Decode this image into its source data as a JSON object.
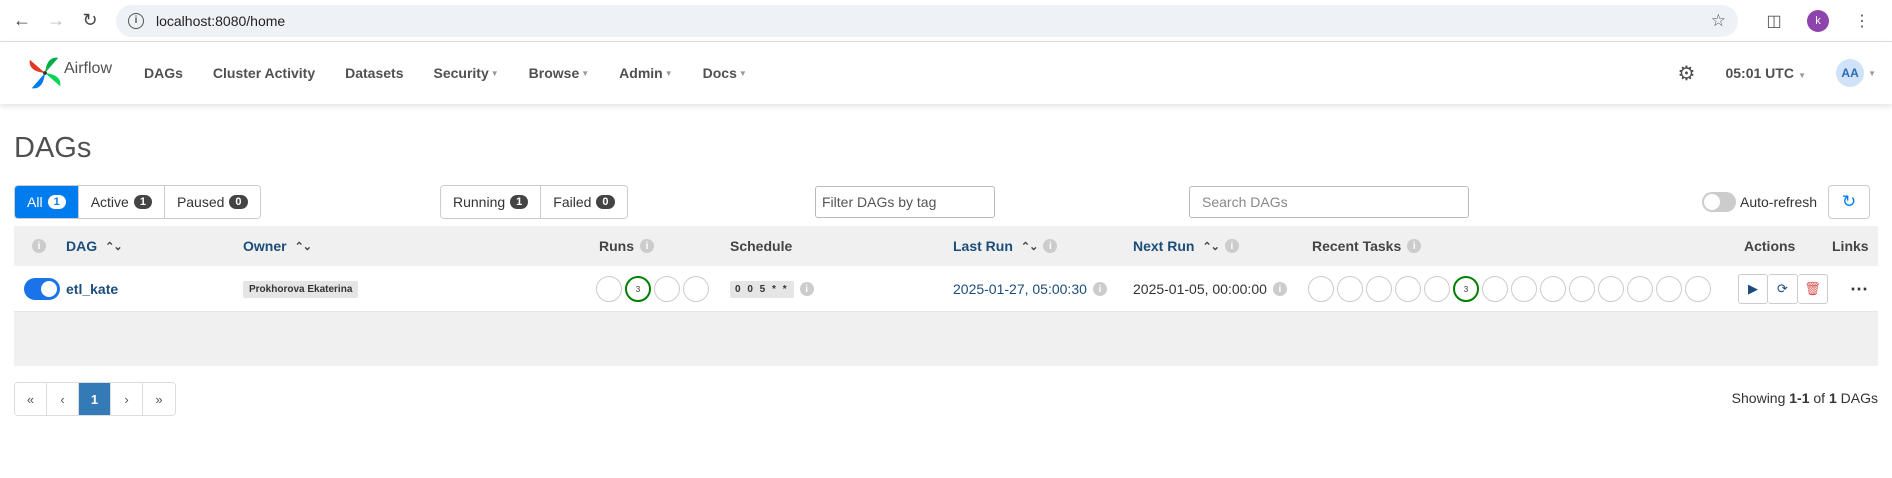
{
  "browser": {
    "url": "localhost:8080/home",
    "profile_initial": "k"
  },
  "navbar": {
    "brand": "Airflow",
    "menu": [
      {
        "label": "DAGs",
        "dropdown": false
      },
      {
        "label": "Cluster Activity",
        "dropdown": false
      },
      {
        "label": "Datasets",
        "dropdown": false
      },
      {
        "label": "Security",
        "dropdown": true
      },
      {
        "label": "Browse",
        "dropdown": true
      },
      {
        "label": "Admin",
        "dropdown": true
      },
      {
        "label": "Docs",
        "dropdown": true
      }
    ],
    "time": "05:01 UTC",
    "user_initials": "AA"
  },
  "page": {
    "title": "DAGs"
  },
  "filters": {
    "all_label": "All",
    "all_count": "1",
    "active_label": "Active",
    "active_count": "1",
    "paused_label": "Paused",
    "paused_count": "0",
    "running_label": "Running",
    "running_count": "1",
    "failed_label": "Failed",
    "failed_count": "0",
    "tag_placeholder": "Filter DAGs by tag",
    "search_placeholder": "Search DAGs",
    "autorefresh_label": "Auto-refresh"
  },
  "table": {
    "headers": {
      "dag": "DAG",
      "owner": "Owner",
      "runs": "Runs",
      "schedule": "Schedule",
      "last_run": "Last Run",
      "next_run": "Next Run",
      "recent_tasks": "Recent Tasks",
      "actions": "Actions",
      "links": "Links"
    },
    "rows": [
      {
        "dag_id": "etl_kate",
        "owner": "Prokhorova Ekaterina",
        "runs_success_count": "3",
        "schedule": "0 0 5 * *",
        "last_run": "2025-01-27, 05:00:30",
        "next_run": "2025-01-05, 00:00:00",
        "recent_tasks_success_count": "3"
      }
    ]
  },
  "pagination": {
    "first": "«",
    "prev": "‹",
    "current": "1",
    "next": "›",
    "last": "»",
    "showing_prefix": "Showing",
    "showing_range": "1-1",
    "showing_of": "of",
    "showing_total": "1",
    "showing_suffix": "DAGs"
  }
}
